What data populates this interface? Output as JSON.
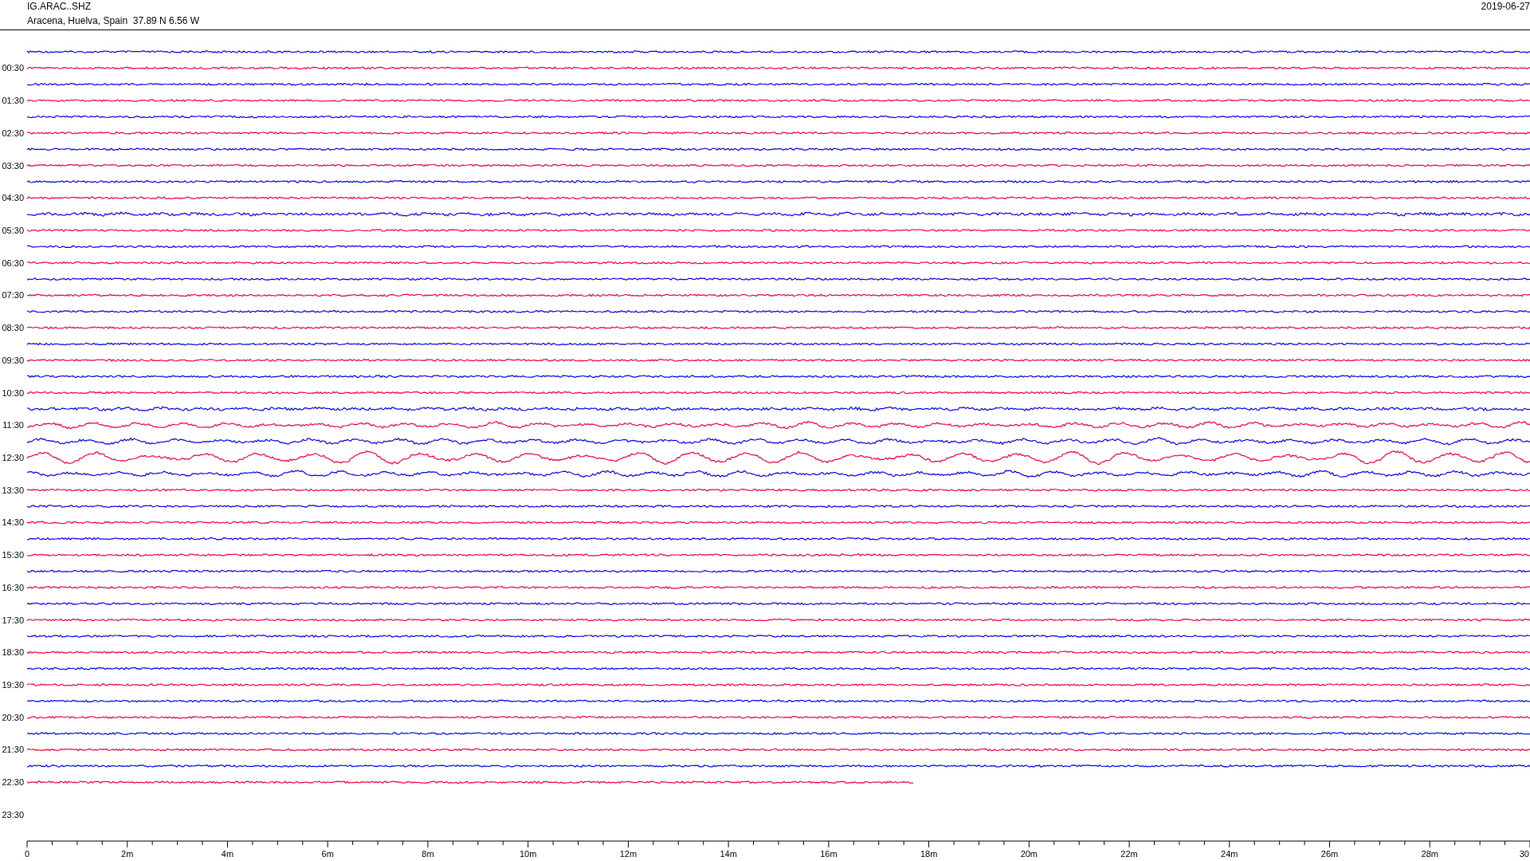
{
  "header": {
    "station": "IG.ARAC..SHZ",
    "location": "Aracena, Huelva, Spain  37.89 N 6.56 W",
    "date": "2019-06-27"
  },
  "rows": [
    {
      "trace": {
        "color": "#0000ff",
        "kind": "quiet"
      }
    },
    {
      "label": "00:30",
      "trace": {
        "color": "#ff0033",
        "kind": "quiet"
      }
    },
    {
      "trace": {
        "color": "#0000ff",
        "kind": "quiet"
      }
    },
    {
      "label": "01:30",
      "trace": {
        "color": "#ff0033",
        "kind": "quiet"
      }
    },
    {
      "trace": {
        "color": "#0000ff",
        "kind": "quiet"
      }
    },
    {
      "label": "02:30",
      "trace": {
        "color": "#ff0033",
        "kind": "quiet"
      }
    },
    {
      "trace": {
        "color": "#0000ff",
        "kind": "quiet"
      }
    },
    {
      "label": "03:30",
      "trace": {
        "color": "#ff0033",
        "kind": "quiet"
      }
    },
    {
      "trace": {
        "color": "#0000ff",
        "kind": "quiet"
      }
    },
    {
      "label": "04:30",
      "trace": {
        "color": "#ff0033",
        "kind": "quiet"
      }
    },
    {
      "trace": {
        "color": "#0000ff",
        "kind": "noisy"
      }
    },
    {
      "label": "05:30",
      "trace": {
        "color": "#ff0033",
        "kind": "quiet"
      }
    },
    {
      "trace": {
        "color": "#0000ff",
        "kind": "quiet"
      }
    },
    {
      "label": "06:30",
      "trace": {
        "color": "#ff0033",
        "kind": "quiet"
      }
    },
    {
      "trace": {
        "color": "#0000ff",
        "kind": "quiet"
      }
    },
    {
      "label": "07:30",
      "trace": {
        "color": "#ff0033",
        "kind": "quiet"
      }
    },
    {
      "trace": {
        "color": "#0000ff",
        "kind": "quiet"
      }
    },
    {
      "label": "08:30",
      "trace": {
        "color": "#ff0033",
        "kind": "quiet"
      }
    },
    {
      "trace": {
        "color": "#0000ff",
        "kind": "quiet"
      }
    },
    {
      "label": "09:30",
      "trace": {
        "color": "#ff0033",
        "kind": "quiet"
      }
    },
    {
      "trace": {
        "color": "#0000ff",
        "kind": "quiet"
      }
    },
    {
      "label": "10:30",
      "trace": {
        "color": "#ff0033",
        "kind": "quiet"
      }
    },
    {
      "trace": {
        "color": "#0000ff",
        "kind": "noisy"
      }
    },
    {
      "label": "11:30",
      "trace": {
        "color": "#ff0033",
        "kind": "wavy"
      }
    },
    {
      "trace": {
        "color": "#0000ff",
        "kind": "wavy"
      }
    },
    {
      "label": "12:30",
      "trace": {
        "color": "#ff0033",
        "kind": "strong"
      }
    },
    {
      "trace": {
        "color": "#0000ff",
        "kind": "wavy"
      }
    },
    {
      "label": "13:30",
      "trace": {
        "color": "#ff0033",
        "kind": "quiet"
      }
    },
    {
      "trace": {
        "color": "#0000ff",
        "kind": "quiet"
      }
    },
    {
      "label": "14:30",
      "trace": {
        "color": "#ff0033",
        "kind": "quiet"
      }
    },
    {
      "trace": {
        "color": "#0000ff",
        "kind": "quiet"
      }
    },
    {
      "label": "15:30",
      "trace": {
        "color": "#ff0033",
        "kind": "quiet"
      }
    },
    {
      "trace": {
        "color": "#0000ff",
        "kind": "quiet"
      }
    },
    {
      "label": "16:30",
      "trace": {
        "color": "#ff0033",
        "kind": "quiet"
      }
    },
    {
      "trace": {
        "color": "#0000ff",
        "kind": "quiet"
      }
    },
    {
      "label": "17:30",
      "trace": {
        "color": "#ff0033",
        "kind": "quiet"
      }
    },
    {
      "trace": {
        "color": "#0000ff",
        "kind": "quiet"
      }
    },
    {
      "label": "18:30",
      "trace": {
        "color": "#ff0033",
        "kind": "quiet"
      }
    },
    {
      "trace": {
        "color": "#0000ff",
        "kind": "quiet"
      }
    },
    {
      "label": "19:30",
      "trace": {
        "color": "#ff0033",
        "kind": "quiet"
      }
    },
    {
      "trace": {
        "color": "#0000ff",
        "kind": "quiet"
      }
    },
    {
      "label": "20:30",
      "trace": {
        "color": "#ff0033",
        "kind": "quiet"
      }
    },
    {
      "trace": {
        "color": "#0000ff",
        "kind": "quiet"
      }
    },
    {
      "label": "21:30",
      "trace": {
        "color": "#ff0033",
        "kind": "quiet"
      }
    },
    {
      "trace": {
        "color": "#0000ff",
        "kind": "quiet"
      }
    },
    {
      "label": "22:30",
      "trace": {
        "color": "#ff0033",
        "kind": "partial"
      }
    },
    {},
    {
      "label": "23:30"
    }
  ],
  "axis": {
    "ticks": [
      "0",
      "2m",
      "4m",
      "6m",
      "8m",
      "10m",
      "12m",
      "14m",
      "16m",
      "18m",
      "20m",
      "22m",
      "24m",
      "26m",
      "28m",
      "30"
    ]
  }
}
